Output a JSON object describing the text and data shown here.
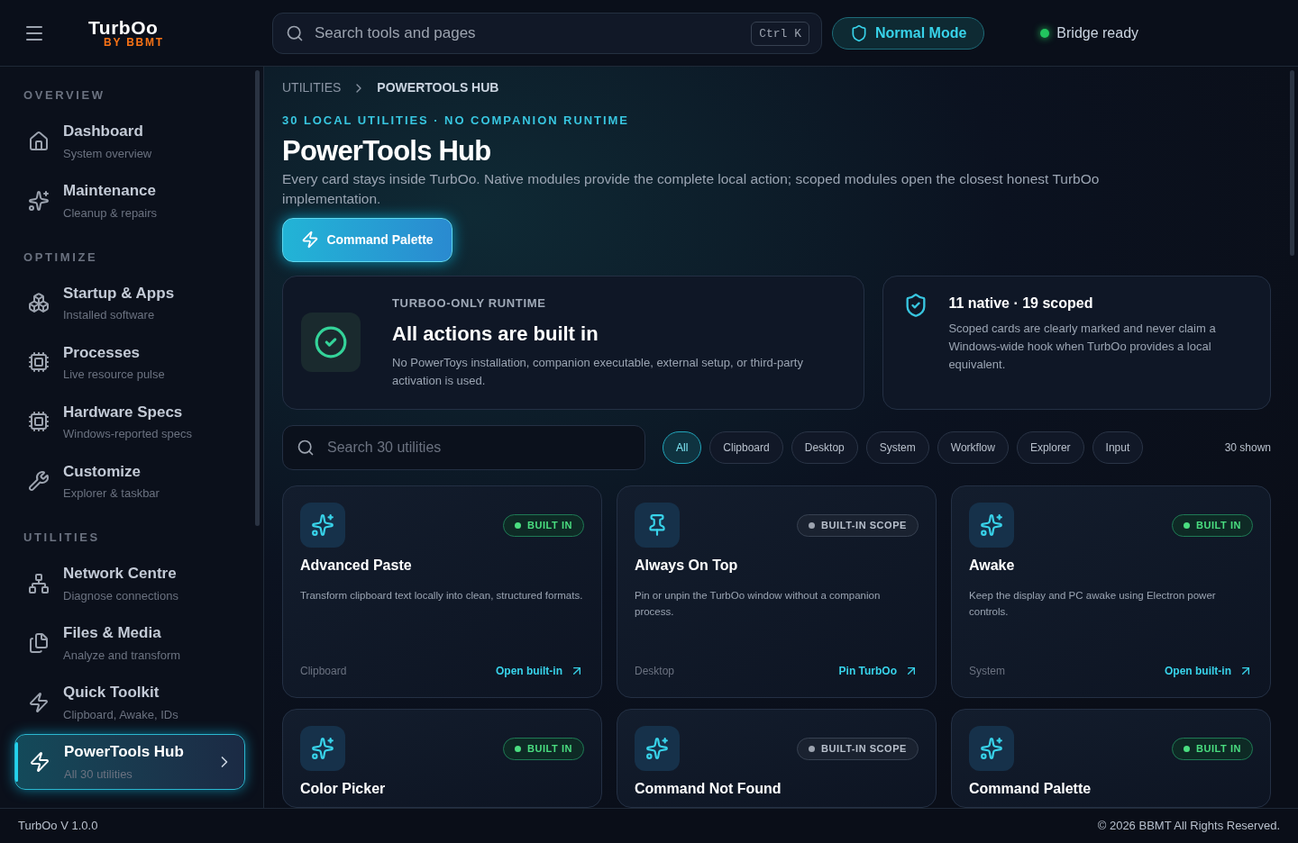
{
  "header": {
    "logo": "TurbOo",
    "logo_sub": "BY BBMT",
    "search": {
      "placeholder": "Search tools and pages",
      "shortcut": "Ctrl K"
    },
    "mode_button": "Normal Mode",
    "status": {
      "label": "Bridge ready",
      "color": "#22c55e"
    }
  },
  "sidebar": {
    "sections": [
      {
        "title": "OVERVIEW",
        "items": [
          {
            "label": "Dashboard",
            "sub": "System overview",
            "selected": false
          },
          {
            "label": "Maintenance",
            "sub": "Cleanup & repairs",
            "selected": false
          }
        ]
      },
      {
        "title": "OPTIMIZE",
        "items": [
          {
            "label": "Startup & Apps",
            "sub": "Installed software",
            "selected": false
          },
          {
            "label": "Processes",
            "sub": "Live resource pulse",
            "selected": false
          },
          {
            "label": "Hardware Specs",
            "sub": "Windows-reported specs",
            "selected": false
          },
          {
            "label": "Customize",
            "sub": "Explorer & taskbar",
            "selected": false
          }
        ]
      },
      {
        "title": "UTILITIES",
        "items": [
          {
            "label": "Network Centre",
            "sub": "Diagnose connections",
            "selected": false
          },
          {
            "label": "Files & Media",
            "sub": "Analyze and transform",
            "selected": false
          },
          {
            "label": "Quick Toolkit",
            "sub": "Clipboard, Awake, IDs",
            "selected": false
          },
          {
            "label": "PowerTools Hub",
            "sub": "All 30 utilities",
            "selected": true
          }
        ]
      }
    ]
  },
  "breadcrumb": [
    "UTILITIES",
    "POWERTOOLS HUB"
  ],
  "eyebrow": "30 LOCAL UTILITIES · NO COMPANION RUNTIME",
  "title": "PowerTools Hub",
  "description": "Every card stays inside TurbOo. Native modules provide the complete local action; scoped modules open the closest honest TurbOo implementation.",
  "primary_button": "Command Palette",
  "runtime_card": {
    "eyebrow": "TURBOO-ONLY RUNTIME",
    "title": "All actions are built in",
    "text": "No PowerToys installation, companion executable, external setup, or third-party activation is used."
  },
  "scope_card": {
    "title": "11 native · 19 scoped",
    "text": "Scoped cards are clearly marked and never claim a Windows-wide hook when TurbOo provides a local equivalent."
  },
  "filter": {
    "placeholder": "Search 30 utilities",
    "count": "30 shown",
    "chips": [
      {
        "label": "All",
        "selected": true
      },
      {
        "label": "Clipboard",
        "selected": false
      },
      {
        "label": "Desktop",
        "selected": false
      },
      {
        "label": "System",
        "selected": false
      },
      {
        "label": "Workflow",
        "selected": false
      },
      {
        "label": "Explorer",
        "selected": false
      },
      {
        "label": "Input",
        "selected": false
      }
    ]
  },
  "utilities": [
    {
      "kind": "native",
      "badge": "BUILT IN",
      "title": "Advanced Paste",
      "text": "Transform clipboard text locally into clean, structured formats.",
      "category": "Clipboard",
      "action": "Open built-in"
    },
    {
      "kind": "scoped",
      "badge": "BUILT-IN SCOPE",
      "title": "Always On Top",
      "text": "Pin or unpin the TurbOo window without a companion process.",
      "category": "Desktop",
      "action": "Pin TurbOo"
    },
    {
      "kind": "native",
      "badge": "BUILT IN",
      "title": "Awake",
      "text": "Keep the display and PC awake using Electron power controls.",
      "category": "System",
      "action": "Open built-in"
    },
    {
      "kind": "native",
      "badge": "BUILT IN",
      "title": "Color Picker"
    },
    {
      "kind": "scoped",
      "badge": "BUILT-IN SCOPE",
      "title": "Command Not Found"
    },
    {
      "kind": "native",
      "badge": "BUILT IN",
      "title": "Command Palette"
    }
  ],
  "footer": {
    "version": "TurbOo V 1.0.0",
    "copyright": "© 2026 BBMT All Rights Reserved."
  }
}
